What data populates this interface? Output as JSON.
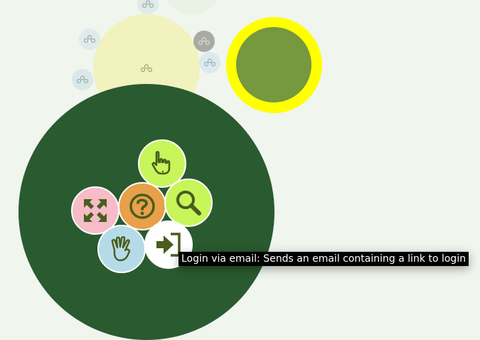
{
  "colors": {
    "background": "#f0f5ee",
    "main_node": "#2a5a30",
    "pale_node": "#f1f2bd",
    "yellow_ring": "#ffff00",
    "olive_center": "#76983e",
    "btn_lime": "#c8f55a",
    "btn_pink": "#f6bcc8",
    "btn_orange": "#e8a04a",
    "btn_lightblue": "#b6dbe8",
    "btn_white": "#ffffff",
    "icon_dark": "#4a5d1e"
  },
  "graph": {
    "small_node_icon": "molecule-icon",
    "selected_node_icon": "olive-circle-icon"
  },
  "menu": {
    "buttons": [
      {
        "name": "pointer-button",
        "icon": "hand-pointer-icon",
        "color": "#c8f55a"
      },
      {
        "name": "expand-button",
        "icon": "arrows-expand-icon",
        "color": "#f6bcc8"
      },
      {
        "name": "help-button",
        "icon": "question-circle-icon",
        "color": "#e8a04a"
      },
      {
        "name": "search-button",
        "icon": "search-icon",
        "color": "#c8f55a"
      },
      {
        "name": "hello-button",
        "icon": "hand-wave-icon",
        "color": "#b6dbe8"
      },
      {
        "name": "login-button",
        "icon": "sign-in-icon",
        "color": "#ffffff"
      }
    ]
  },
  "tooltip": {
    "text": "Login via email: Sends an email containing a link to login"
  }
}
